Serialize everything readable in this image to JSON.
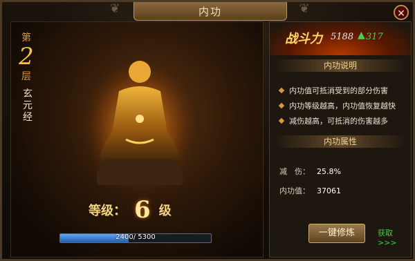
{
  "window": {
    "title": "内功",
    "close_label": "✕"
  },
  "left": {
    "layer_prefix": "第",
    "layer_number": "2",
    "layer_suffix": "层",
    "skill_chars": [
      "玄",
      "元",
      "经"
    ],
    "level_label": "等级：",
    "level_value": "6",
    "level_unit": "级",
    "progress": {
      "current": 2400,
      "max": 5300,
      "text": "2400/ 5300"
    }
  },
  "right": {
    "power": {
      "label": "战斗力",
      "value": "5188",
      "increase": "317"
    },
    "desc_title": "内功说明",
    "desc_items": [
      "内功值可抵消受到的部分伤害",
      "内功等级越高，内功值恢复越快",
      "减伤越高，可抵消的伤害越多"
    ],
    "attr_title": "内功属性",
    "attrs": [
      {
        "label": "减　伤：",
        "value": "25.8%"
      },
      {
        "label": "内功值：",
        "value": "37061"
      }
    ],
    "train_button": "一键修炼",
    "get_link": "获取>>>"
  },
  "colors": {
    "accent_gold": "#f5d583",
    "progress_blue": "#3f86d6",
    "link_green": "#39d43e"
  }
}
